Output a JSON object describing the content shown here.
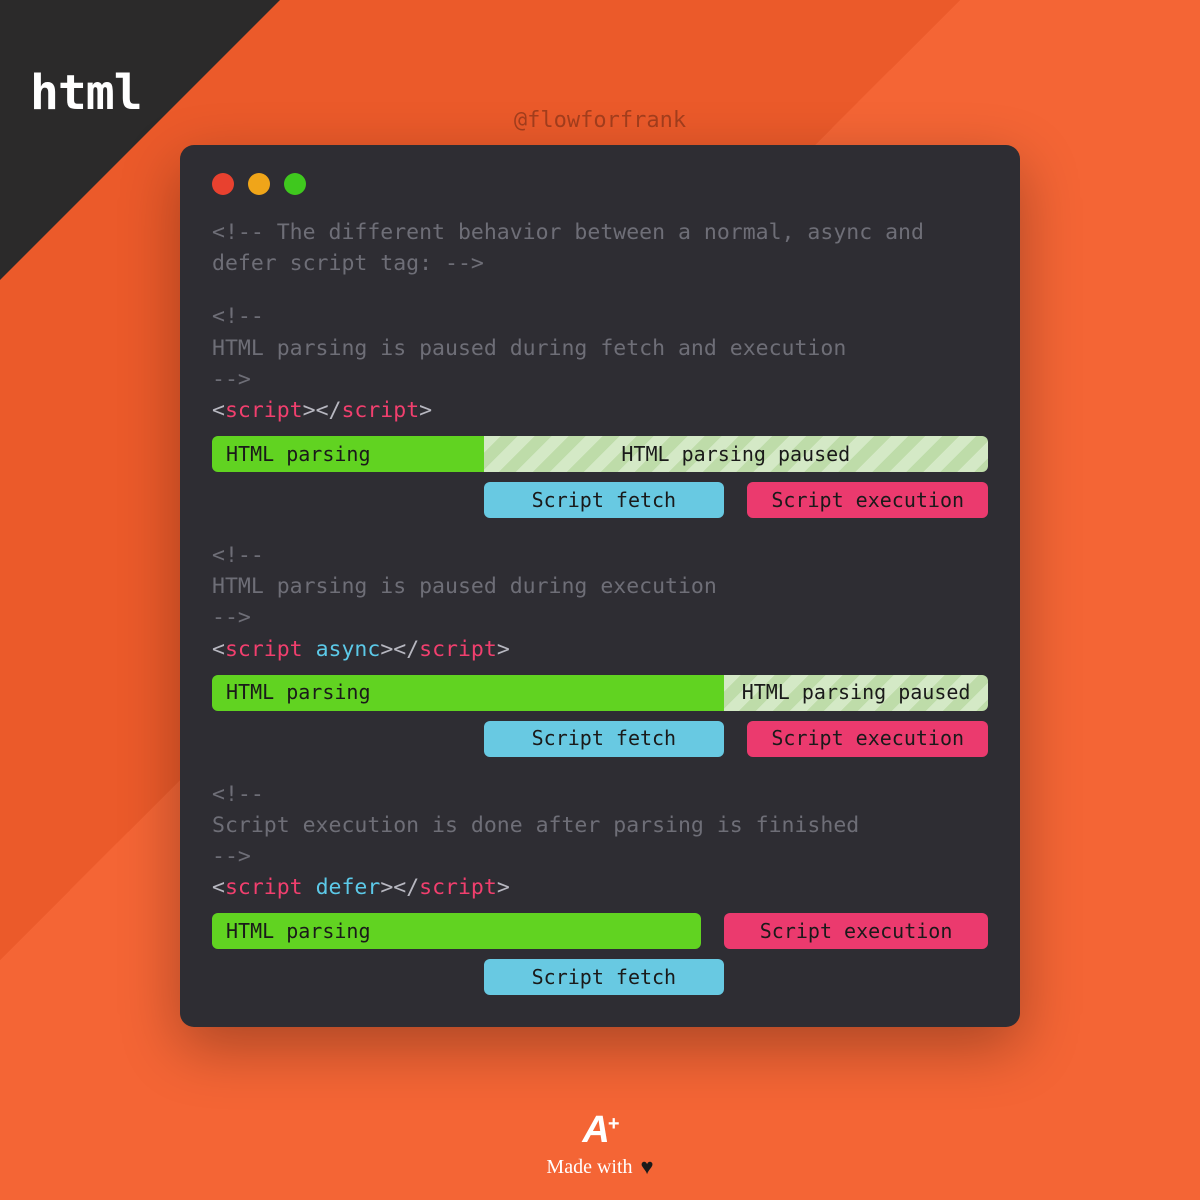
{
  "corner_label": "html",
  "handle": "@flowforfrank",
  "intro_comment": "<!-- The different behavior between a normal, async and defer script tag: -->",
  "sections": {
    "normal": {
      "comment_open": "<!--",
      "comment_text": "  HTML parsing is paused during fetch and execution",
      "comment_close": "-->",
      "tag_open_bracket": "<",
      "tag_name": "script",
      "tag_close_bracket": "></",
      "tag_close_name": "script",
      "tag_end": ">",
      "bars": {
        "parse_label": "HTML parsing",
        "paused_label": "HTML parsing paused",
        "fetch_label": "Script fetch",
        "exec_label": "Script execution"
      }
    },
    "async": {
      "comment_open": "<!--",
      "comment_text": "  HTML parsing is paused during execution",
      "comment_close": "-->",
      "tag_open_bracket": "<",
      "tag_name": "script",
      "tag_attr": "async",
      "tag_close_bracket": "></",
      "tag_close_name": "script",
      "tag_end": ">",
      "bars": {
        "parse_label": "HTML parsing",
        "paused_label": "HTML parsing paused",
        "fetch_label": "Script fetch",
        "exec_label": "Script execution"
      }
    },
    "defer": {
      "comment_open": "<!--",
      "comment_text": "  Script execution is done after parsing is finished",
      "comment_close": "-->",
      "tag_open_bracket": "<",
      "tag_name": "script",
      "tag_attr": "defer",
      "tag_close_bracket": "></",
      "tag_close_name": "script",
      "tag_end": ">",
      "bars": {
        "parse_label": "HTML parsing",
        "fetch_label": "Script fetch",
        "exec_label": "Script execution"
      }
    }
  },
  "footer": {
    "logo_text": "A",
    "logo_sup": "+",
    "made_with": "Made with"
  },
  "colors": {
    "parse": "#61d321",
    "paused": "#d4e9c6",
    "fetch": "#68c9e2",
    "exec": "#eb3a6e"
  }
}
